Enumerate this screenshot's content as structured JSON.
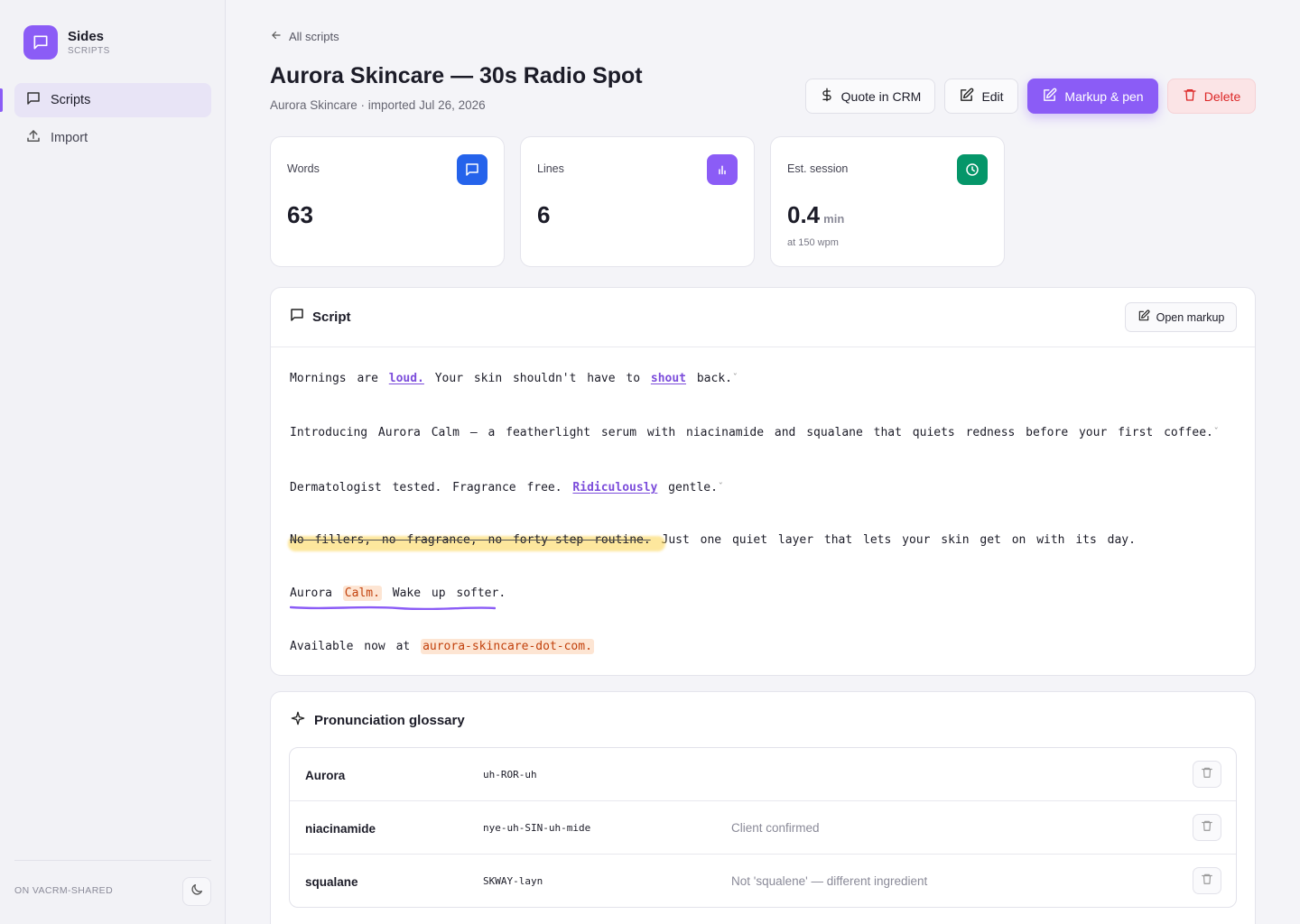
{
  "brand": {
    "name": "Sides",
    "subtitle": "SCRIPTS"
  },
  "sidebar": {
    "items": [
      {
        "label": "Scripts",
        "icon": "message-square-icon",
        "active": true
      },
      {
        "label": "Import",
        "icon": "upload-icon",
        "active": false
      }
    ],
    "footer_label": "ON VACRM-SHARED"
  },
  "header": {
    "back_label": "All scripts",
    "title": "Aurora Skincare — 30s Radio Spot",
    "subtitle": "Aurora Skincare · imported Jul 26, 2026",
    "buttons": {
      "quote": "Quote in CRM",
      "edit": "Edit",
      "markup": "Markup & pen",
      "delete": "Delete"
    }
  },
  "stats": [
    {
      "label": "Words",
      "value": "63",
      "icon": "message-square-icon",
      "color": "#2563eb"
    },
    {
      "label": "Lines",
      "value": "6",
      "icon": "bar-chart-icon",
      "color": "#8b5cf6"
    },
    {
      "label": "Est. session",
      "value": "0.4",
      "unit": "min",
      "note": "at 150 wpm",
      "icon": "clock-icon",
      "color": "#059669"
    }
  ],
  "script": {
    "title": "Script",
    "open_markup_label": "Open markup",
    "lines": [
      {
        "parts": [
          "Mornings are ",
          "loud.",
          " Your skin shouldn't have to ",
          "shout",
          " back."
        ]
      },
      {
        "parts": [
          "Introducing Aurora Calm — a featherlight serum with niacinamide and squalane that quiets redness before your first coffee."
        ]
      },
      {
        "parts": [
          "Dermatologist tested. Fragrance free. ",
          "Ridiculously",
          " gentle."
        ]
      },
      {
        "parts": [
          "No fillers, no fragrance, no forty-step routine.",
          " Just one quiet layer that lets your skin get on with its day."
        ]
      },
      {
        "parts": [
          "Aurora ",
          "Calm.",
          " Wake up softer."
        ]
      },
      {
        "parts": [
          "Available now at ",
          "aurora-skincare-dot-com."
        ]
      }
    ],
    "breath_mark": "ˇ"
  },
  "glossary": {
    "title": "Pronunciation glossary",
    "rows": [
      {
        "term": "Aurora",
        "pronunciation": "uh-ROR-uh",
        "note": ""
      },
      {
        "term": "niacinamide",
        "pronunciation": "nye-uh-SIN-uh-mide",
        "note": "Client confirmed"
      },
      {
        "term": "squalane",
        "pronunciation": "SKWAY-layn",
        "note": "Not 'squalene' — different ingredient"
      }
    ]
  },
  "colors": {
    "accent": "#8b5cf6",
    "danger": "#dc2626",
    "highlight": "#fcd34d",
    "tag": "#c2410c"
  }
}
